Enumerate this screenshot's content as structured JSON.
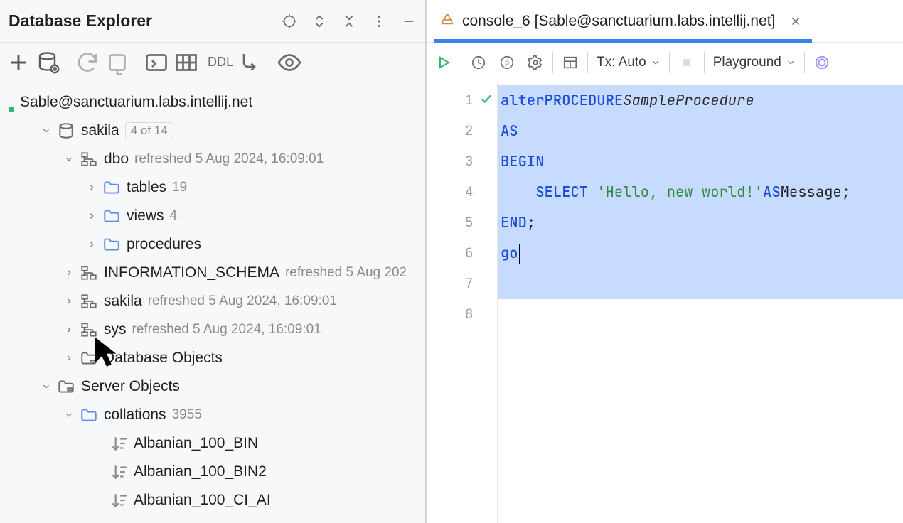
{
  "panel": {
    "title": "Database Explorer"
  },
  "toolbar": {
    "ddl": "DDL"
  },
  "tree": {
    "connection": "Sable@sanctuarium.labs.intellij.net",
    "db": {
      "name": "sakila",
      "count": "4 of 14"
    },
    "schemas": {
      "dbo": {
        "name": "dbo",
        "meta": "refreshed 5 Aug 2024, 16:09:01"
      },
      "tables": {
        "name": "tables",
        "count": "19"
      },
      "views": {
        "name": "views",
        "count": "4"
      },
      "procedures": {
        "name": "procedures"
      },
      "info": {
        "name": "INFORMATION_SCHEMA",
        "meta": "refreshed 5 Aug 202"
      },
      "sakila": {
        "name": "sakila",
        "meta": "refreshed 5 Aug 2024, 16:09:01"
      },
      "sys": {
        "name": "sys",
        "meta": "refreshed 5 Aug 2024, 16:09:01"
      }
    },
    "db_objects": "Database Objects",
    "server_objects": "Server Objects",
    "collations": {
      "name": "collations",
      "count": "3955"
    },
    "col_items": {
      "a": "Albanian_100_BIN",
      "b": "Albanian_100_BIN2",
      "c": "Albanian_100_CI_AI"
    }
  },
  "tab": {
    "title": "console_6 [Sable@sanctuarium.labs.intellij.net]"
  },
  "rtoolbar": {
    "tx": "Tx: Auto",
    "mode": "Playground"
  },
  "code": {
    "l1a": "alter ",
    "l1b": "PROCEDURE ",
    "l1c": "SampleProcedure",
    "l2": "AS",
    "l3": "BEGIN",
    "l4a": "    SELECT ",
    "l4b": "'Hello, new world!'",
    "l4c": " AS ",
    "l4d": "Message",
    "l4e": ";",
    "l5": "END",
    "l5b": ";",
    "l6": "go"
  },
  "gutter": {
    "1": "1",
    "2": "2",
    "3": "3",
    "4": "4",
    "5": "5",
    "6": "6",
    "7": "7",
    "8": "8"
  }
}
